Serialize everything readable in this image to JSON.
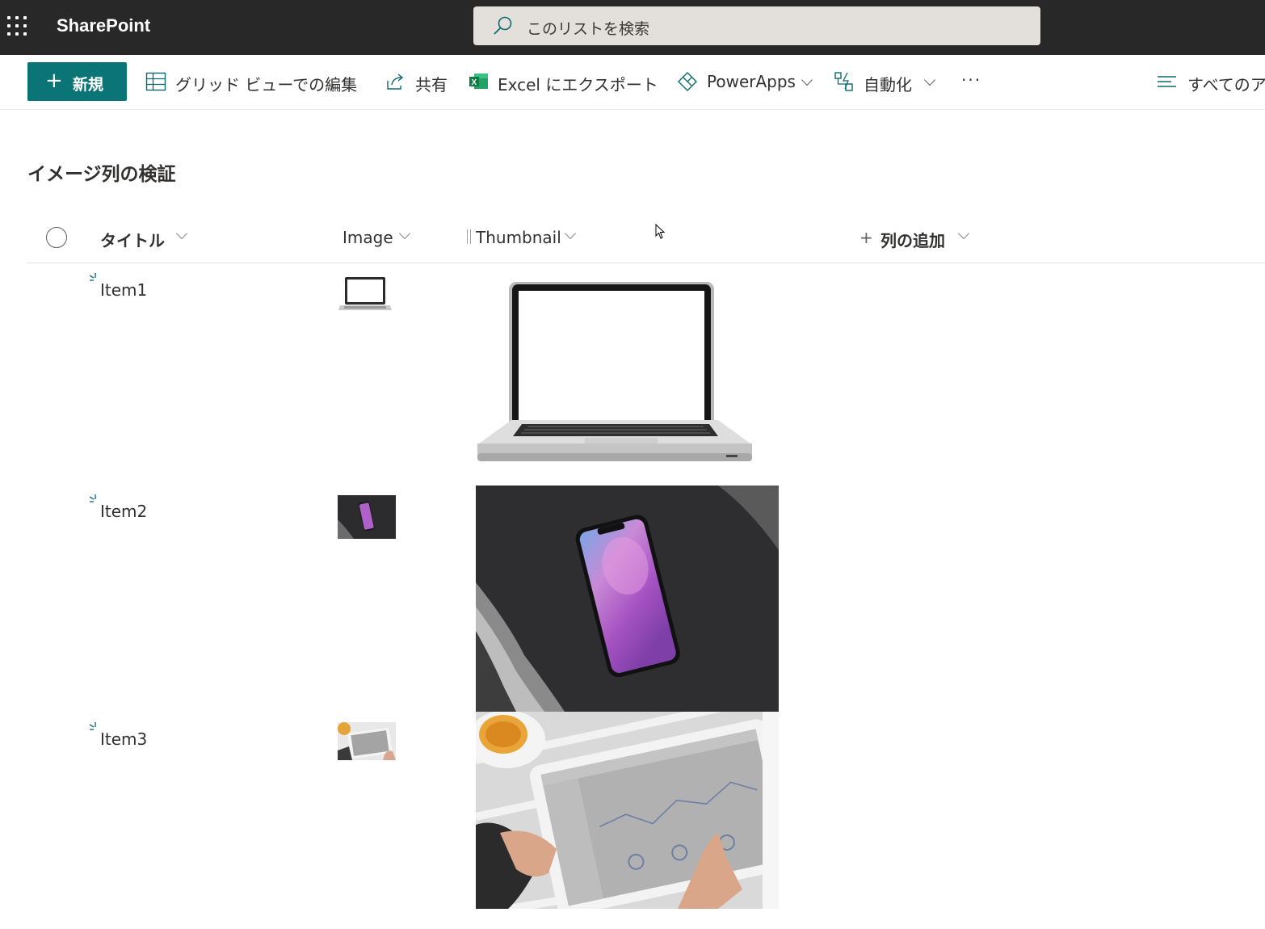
{
  "suite": {
    "app_name": "SharePoint",
    "search_placeholder": "このリストを検索"
  },
  "commands": {
    "new": "新規",
    "grid_edit": "グリッド ビューでの編集",
    "share": "共有",
    "export_excel": "Excel にエクスポート",
    "powerapps": "PowerApps",
    "automate": "自動化",
    "more": "···",
    "view_selector": "すべてのア"
  },
  "list": {
    "title": "イメージ列の検証",
    "columns": {
      "title": "タイトル",
      "image": "Image",
      "thumbnail": "Thumbnail",
      "add_column": "列の追加"
    },
    "items": [
      {
        "title": "Item1",
        "image": "laptop"
      },
      {
        "title": "Item2",
        "image": "smartphone"
      },
      {
        "title": "Item3",
        "image": "tablet"
      }
    ]
  },
  "colors": {
    "suite_bar": "#282828",
    "accent": "#0b7477",
    "search_bg": "#e3dfdb"
  }
}
